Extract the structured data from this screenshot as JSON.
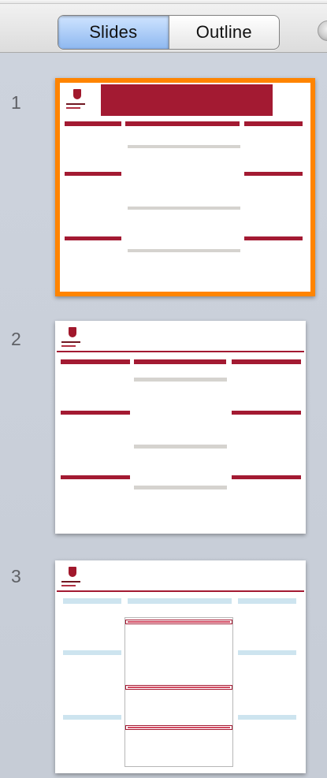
{
  "toolbar": {
    "tabs": [
      {
        "label": "Slides",
        "active": true
      },
      {
        "label": "Outline",
        "active": false
      }
    ]
  },
  "slides": [
    {
      "number": "1",
      "selected": true
    },
    {
      "number": "2",
      "selected": false
    },
    {
      "number": "3",
      "selected": false
    }
  ],
  "colors": {
    "selection_border": "#ff8400",
    "accent_red": "#a31a32",
    "segment_active": "#9fc5f5"
  }
}
